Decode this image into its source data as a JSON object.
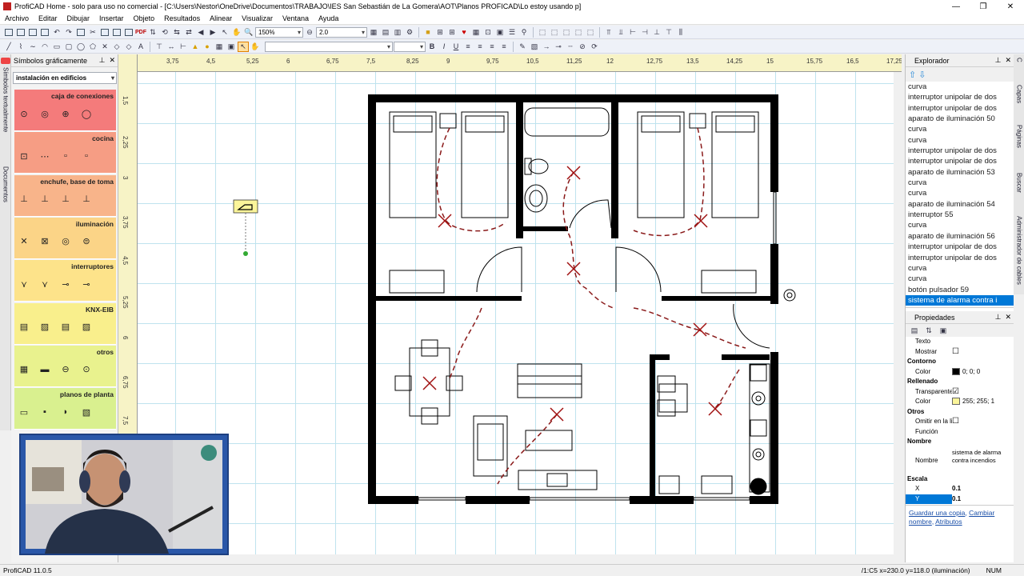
{
  "window": {
    "title": "ProfiCAD Home - solo para uso no comercial - [C:\\Users\\Nestor\\OneDrive\\Documentos\\TRABAJO\\IES San Sebastián de La Gomera\\AOT\\Planos PROFICAD\\Lo estoy usando p]",
    "min": "—",
    "max": "❐",
    "close": "✕"
  },
  "menu": [
    "Archivo",
    "Editar",
    "Dibujar",
    "Insertar",
    "Objeto",
    "Resultados",
    "Alinear",
    "Visualizar",
    "Ventana",
    "Ayuda"
  ],
  "toolbar": {
    "zoom": "150%",
    "line_width": "2.0"
  },
  "left_tabs": [
    "Símbolos textualmente",
    "Documentos"
  ],
  "symbols_panel": {
    "title": "Símbolos gráficamente",
    "pin": "⊥",
    "close": "✕",
    "library": "instalación en edificios",
    "categories": [
      {
        "label": "caja de conexiones",
        "color": "#f47b7b",
        "icons": [
          "⊙",
          "◎",
          "⊕",
          "◯"
        ]
      },
      {
        "label": "cocina",
        "color": "#f69d84",
        "icons": [
          "⊡",
          "⋯",
          "▫",
          "▫"
        ]
      },
      {
        "label": "enchufe, base de toma",
        "color": "#f8b48a",
        "icons": [
          "⊥",
          "⊥",
          "⊥",
          "⊥"
        ]
      },
      {
        "label": "iluminación",
        "color": "#fbd487",
        "icons": [
          "✕",
          "⊠",
          "◎",
          "⊜"
        ]
      },
      {
        "label": "interruptores",
        "color": "#fde38a",
        "icons": [
          "⋎",
          "⋎",
          "⊸",
          "⊸"
        ]
      },
      {
        "label": "KNX-EIB",
        "color": "#f9ef8c",
        "icons": [
          "▤",
          "▨",
          "▤",
          "▨"
        ]
      },
      {
        "label": "otros",
        "color": "#e9f28e",
        "icons": [
          "▦",
          "▬",
          "⊖",
          "⊙"
        ]
      },
      {
        "label": "planos de planta",
        "color": "#d9f08f",
        "icons": [
          "▭",
          "▪",
          "◗",
          "▧"
        ]
      }
    ]
  },
  "hruler": [
    "3,75",
    "4,5",
    "5,25",
    "6",
    "6,75",
    "7,5",
    "8,25",
    "9",
    "9,75",
    "10,5",
    "11,25",
    "12",
    "12,75",
    "13,5",
    "14,25",
    "15",
    "15,75",
    "16,5",
    "17,25"
  ],
  "vruler": [
    "1,5",
    "2,25",
    "3",
    "3,75",
    "4,5",
    "5,25",
    "6",
    "6,75",
    "7,5"
  ],
  "explorer": {
    "title": "Explorador",
    "items": [
      "curva",
      "interruptor unipolar de dos",
      "interruptor unipolar de dos",
      "aparato de iluminación 50",
      "curva",
      "curva",
      "interruptor unipolar de dos",
      "interruptor unipolar de dos",
      "aparato de iluminación 53",
      "curva",
      "curva",
      "aparato de iluminación 54",
      "interruptor 55",
      "curva",
      "aparato de iluminación 56",
      "interruptor unipolar de dos",
      "interruptor unipolar de dos",
      "curva",
      "curva",
      "botón pulsador 59",
      "sistema de alarma contra i"
    ],
    "selected_index": 20
  },
  "properties": {
    "title": "Propiedades",
    "rows": [
      {
        "type": "row",
        "k": "Texto",
        "v": ""
      },
      {
        "type": "row",
        "k": "Mostrar",
        "v": "",
        "check": "☐"
      },
      {
        "type": "sec",
        "k": "Contorno"
      },
      {
        "type": "row",
        "k": "Color",
        "v": "0; 0; 0",
        "swatch": "#000000"
      },
      {
        "type": "sec",
        "k": "Rellenado"
      },
      {
        "type": "row",
        "k": "Transparente",
        "v": "",
        "check": "☑"
      },
      {
        "type": "row",
        "k": "Color",
        "v": "255; 255; 1",
        "swatch": "#fbf59a"
      },
      {
        "type": "sec",
        "k": "Otros"
      },
      {
        "type": "row",
        "k": "Omitir en la lis",
        "v": "",
        "check": "☐"
      },
      {
        "type": "row",
        "k": "Función",
        "v": ""
      },
      {
        "type": "sec",
        "k": "Nombre"
      },
      {
        "type": "tall",
        "k": "Nombre",
        "v": "sistema de alarma contra incendios"
      },
      {
        "type": "sec",
        "k": "Escala"
      },
      {
        "type": "row",
        "k": "X",
        "v": "0.1"
      },
      {
        "type": "row",
        "k": "Y",
        "v": "0.1",
        "sel": true
      }
    ],
    "links": [
      "Guardar una copia",
      "Cambiar nombre",
      "Atributos"
    ]
  },
  "right_tabs": [
    "Capas",
    "Páginas",
    "Buscar",
    "Administrador de cables"
  ],
  "status": {
    "version": "ProfiCAD 11.0.5",
    "info": "/1:C5  x=230.0  y=118.0 (iluminación)",
    "num": "NUM"
  }
}
